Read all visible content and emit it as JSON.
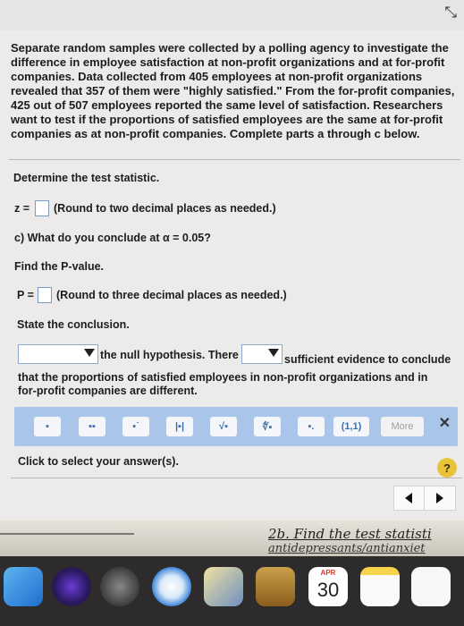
{
  "question": {
    "text": "Separate random samples were collected by a polling agency to investigate the difference in employee satisfaction at non-profit organizations and at for-profit companies. Data collected from 405 employees at non-profit organizations revealed that 357 of them were \"highly satisfied.\" From the for-profit companies, 425 out of 507 employees reported the same level of satisfaction. Researchers want to test if the proportions of satisfied employees are the same at for-profit companies as at non-profit companies. Complete parts a through c below."
  },
  "part_b": {
    "heading": "Determine the test statistic.",
    "z_label": "z =",
    "z_value": "",
    "z_note": "(Round to two decimal places as needed.)"
  },
  "part_c": {
    "heading": "c) What do you conclude at α = 0.05?",
    "pvalue_prompt": "Find the P-value.",
    "p_label": "P =",
    "p_value": "",
    "p_note": "(Round to three decimal places as needed.)",
    "conclusion_prompt": "State the conclusion.",
    "dropdown1_value": "",
    "text_mid": "the null hypothesis. There",
    "dropdown2_value": "",
    "text_end": "sufficient evidence to conclude",
    "text_line2": "that the proportions of satisfied employees in non-profit organizations and in",
    "text_line3": "for-profit companies are different."
  },
  "toolbar": {
    "buttons": [
      "fraction-icon",
      "mixed-number-icon",
      "exponent-icon",
      "absolute-value-icon",
      "square-root-icon",
      "nth-root-icon",
      "decimal-icon",
      "interval-icon"
    ],
    "interval_label": "(1,1)",
    "more_label": "More",
    "close_label": "✕"
  },
  "status": {
    "hint": "Click to select your answer(s).",
    "help_label": "?"
  },
  "notebook": {
    "line1": "2b. Find the test statisti",
    "line2": "antidepressants/antianxiet"
  },
  "dock": {
    "calendar_month": "APR",
    "calendar_day": "30"
  },
  "colors": {
    "toolbar_bg": "#a9c5e9",
    "help_badge": "#e8c23a",
    "input_border": "#7a9cc2"
  }
}
